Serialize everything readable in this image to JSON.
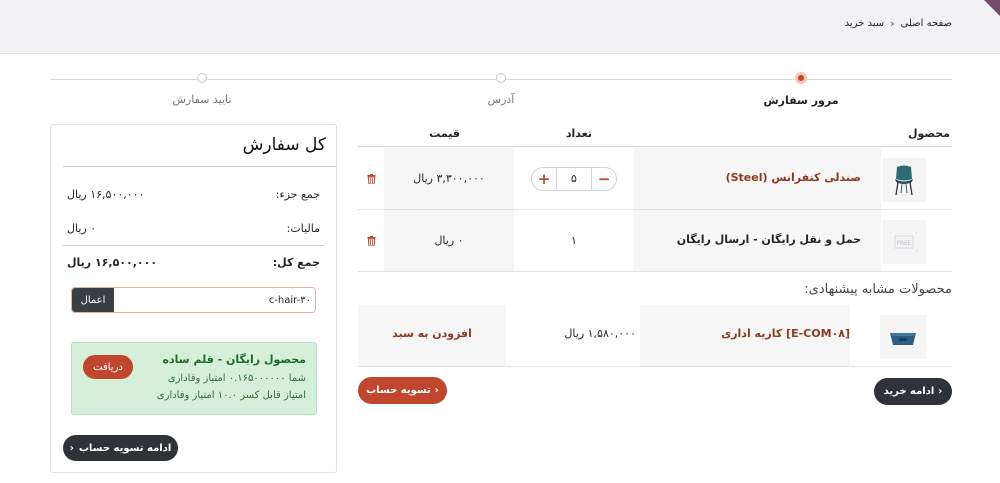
{
  "breadcrumb": {
    "home": "صفحه اصلی",
    "current": "سبد خرید"
  },
  "steps": [
    {
      "label": "مرور سفارش",
      "active": true
    },
    {
      "label": "آدرس",
      "active": false
    },
    {
      "label": "تایید سفارش",
      "active": false
    }
  ],
  "cart": {
    "headers": {
      "product": "محصول",
      "quantity": "تعداد",
      "price": "قیمت"
    },
    "rows": [
      {
        "name": "صندلی کنفرانس (Steel)",
        "quantity": "۵",
        "price": "۳,۳۰۰,۰۰۰ ریال",
        "icon": "chair-icon"
      },
      {
        "name": "حمل و نقل رایگان - ارسال رایگان",
        "quantity": "۱",
        "price": "۰ ریال",
        "icon": "shipping-icon"
      }
    ]
  },
  "suggested": {
    "title": "محصولات مشابه پیشنهادی:",
    "items": [
      {
        "name": "[E-COM۰۸] کازیه اداری",
        "price": "۱,۵۸۰,۰۰۰ ریال",
        "add_label": "افزودن به سبد",
        "icon": "tray-icon"
      }
    ]
  },
  "actions": {
    "continue_shopping": "ادامه خرید",
    "checkout": "تسویه حساب"
  },
  "summary": {
    "title": "کل سفارش",
    "subtotal_label": "جمع جزء:",
    "subtotal_value": "۱۶,۵۰۰,۰۰۰ ریال",
    "tax_label": "مالیات:",
    "tax_value": "۰ ریال",
    "total_label": "جمع کل:",
    "total_value": "۱۶,۵۰۰,۰۰۰ ریال",
    "promo_value": "c-hair-۳۰",
    "promo_button": "اعمال",
    "reward": {
      "title": "محصول رایگان - قلم ساده",
      "line1": "شما ۰.۱۶۵۰۰۰۰۰۰ امتیاز وفاداری",
      "line2": "امتیاز قابل کسر ۱۰.۰ امتیاز وفاداری",
      "button": "دریافت"
    },
    "continue_checkout": "ادامه تسویه حساب"
  },
  "colors": {
    "accent": "#c0462d",
    "dark_button": "#2f3338",
    "link": "#8c3a1f",
    "brand": "#714b67",
    "reward_bg": "#d6efd9"
  }
}
